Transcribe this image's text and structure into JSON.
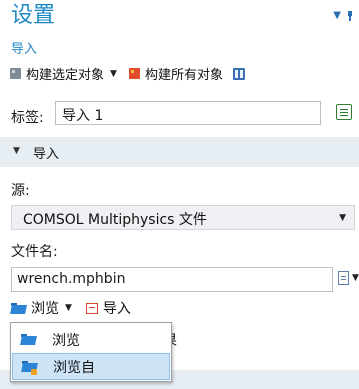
{
  "header": {
    "title": "设置",
    "subtitle": "导入"
  },
  "build_toolbar": {
    "build_selected_label": "构建选定对象",
    "build_all_label": "构建所有对象"
  },
  "label_row": {
    "label": "标签:",
    "value": "导入 1"
  },
  "section": {
    "title": "导入"
  },
  "source": {
    "label": "源:",
    "selected": "COMSOL Multiphysics 文件"
  },
  "filename": {
    "label": "文件名:",
    "value": "wrench.mphbin"
  },
  "browse_row": {
    "browse_label": "浏览",
    "import_label": "导入"
  },
  "partially_hidden_text": "果",
  "browse_menu": {
    "items": [
      {
        "label": "浏览",
        "icon": "folder-open-icon"
      },
      {
        "label": "浏览自",
        "icon": "folder-from-icon"
      }
    ],
    "highlighted_index": 1
  },
  "colors": {
    "accent": "#1e88c7",
    "section_bg": "#e6edf3",
    "menu_highlight": "#cde4f7"
  }
}
